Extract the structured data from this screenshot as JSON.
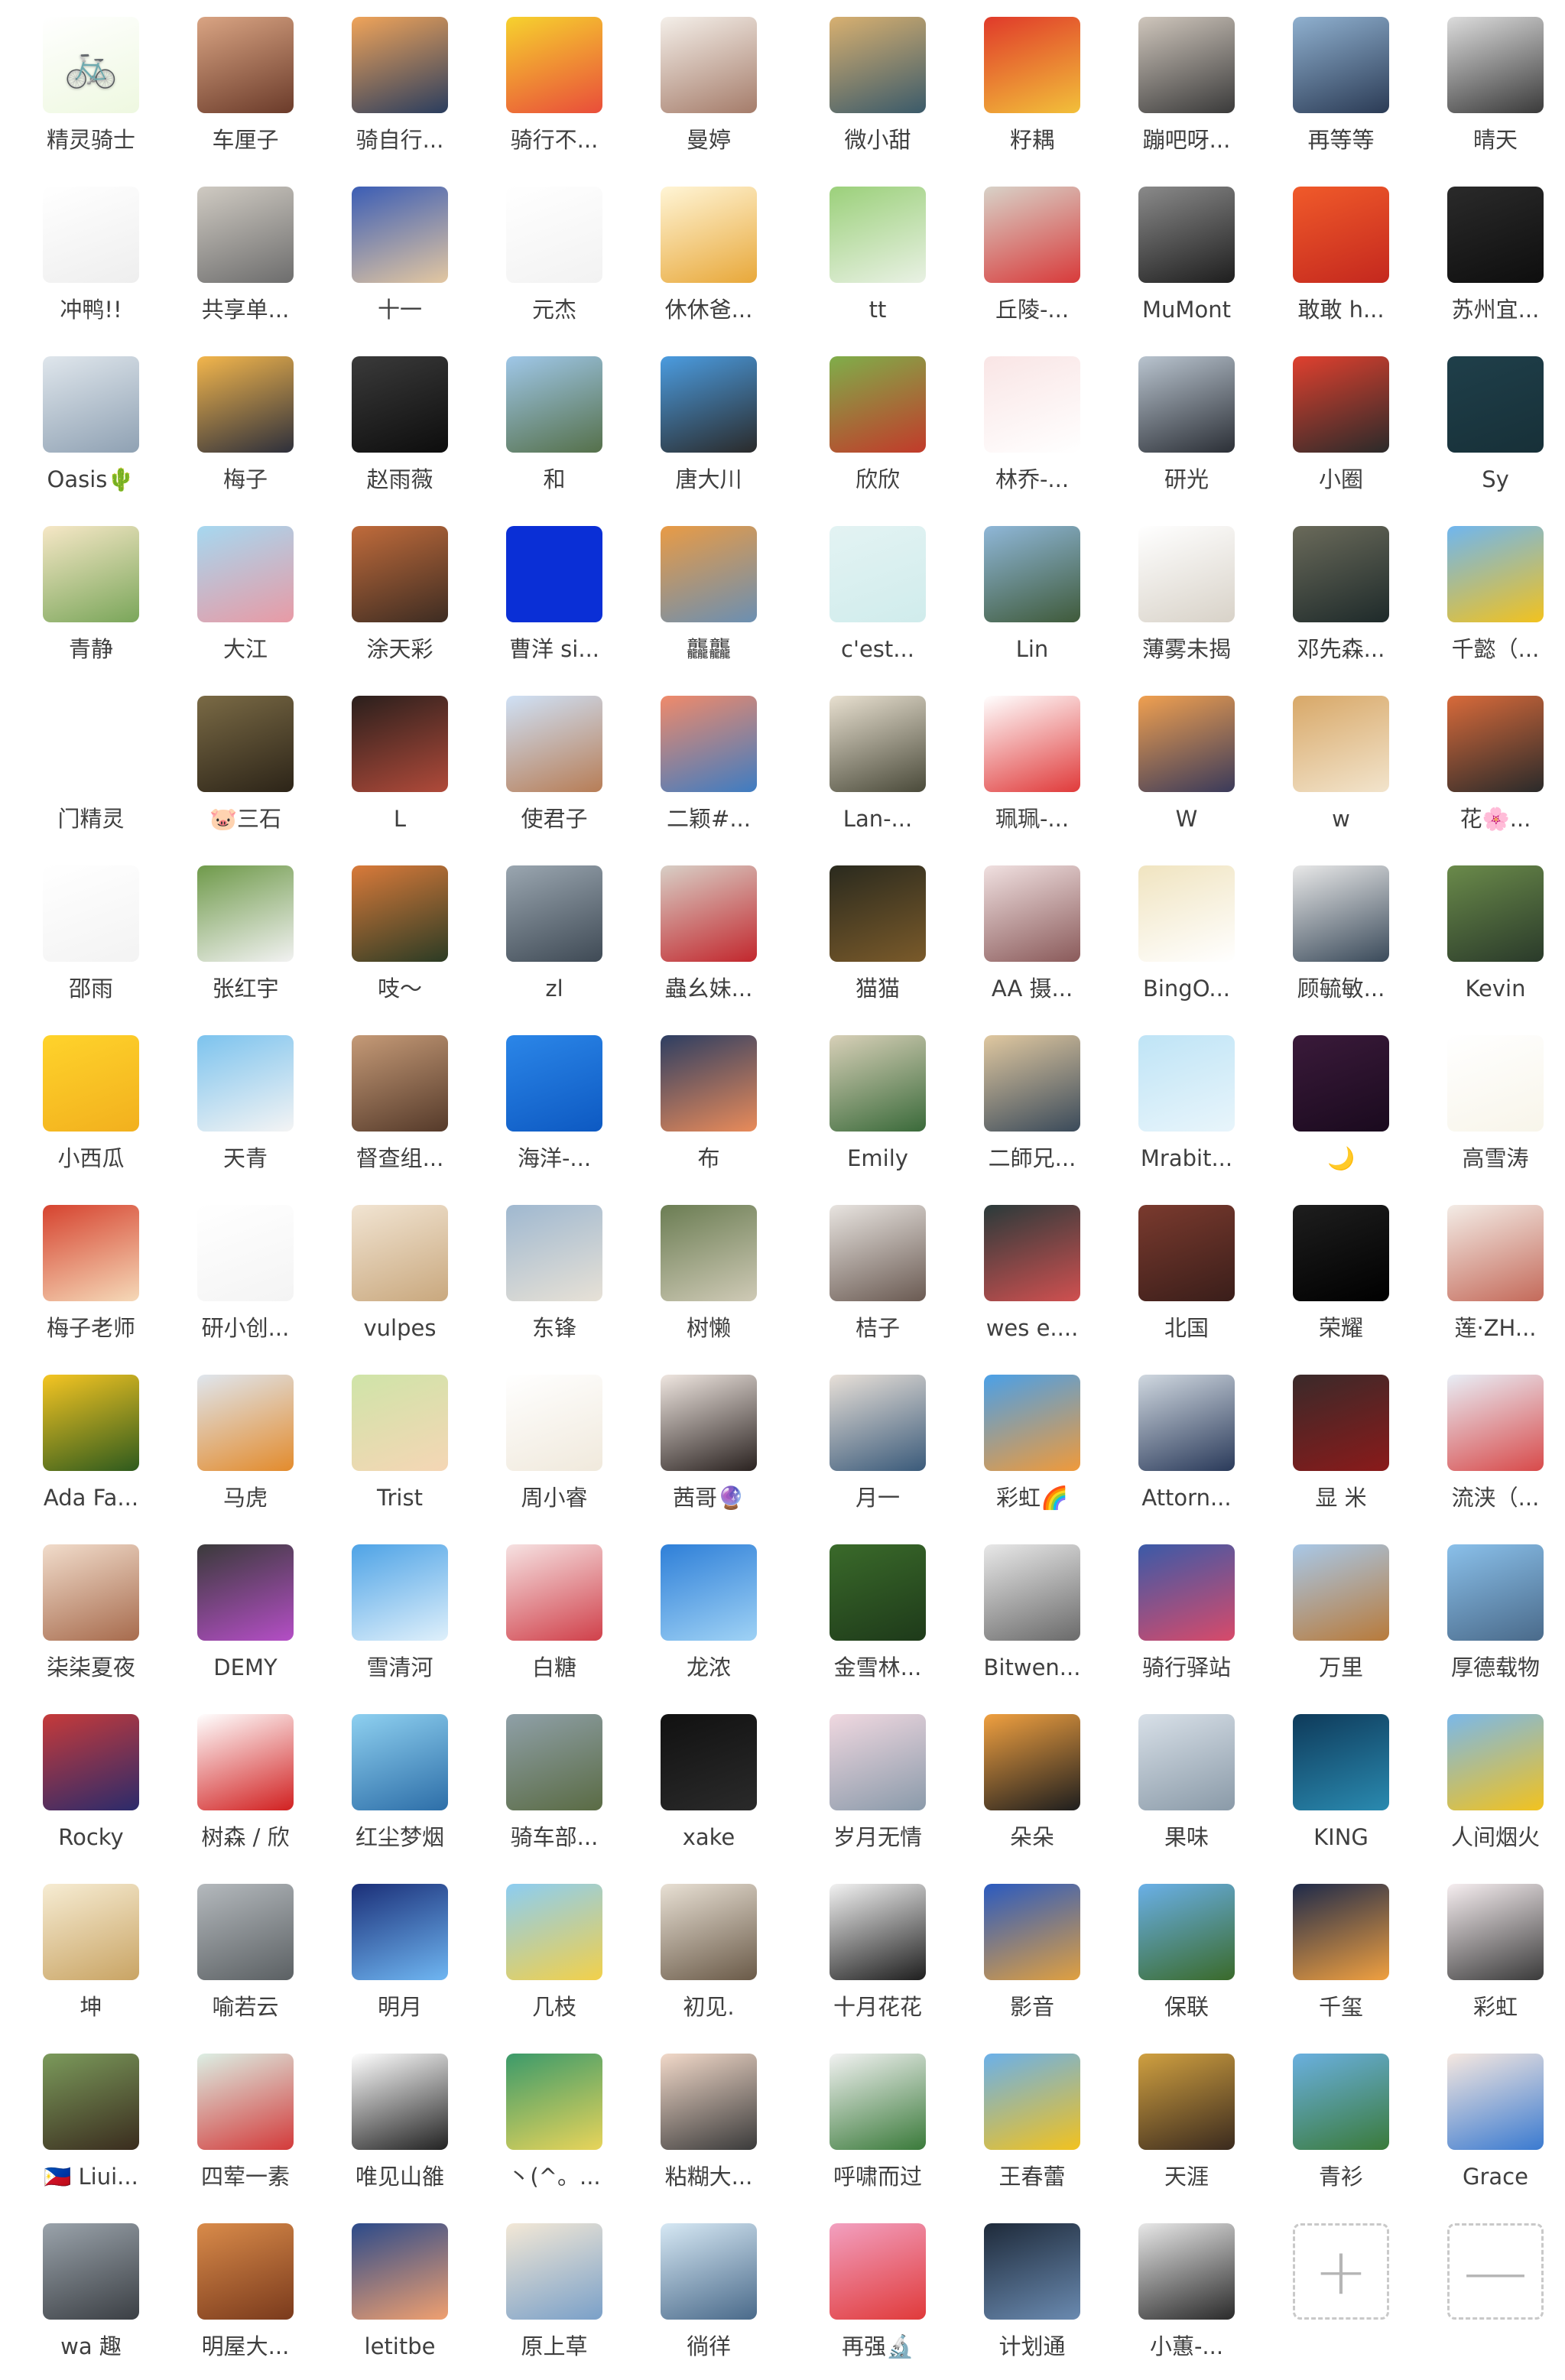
{
  "left_panel": {
    "members": [
      {
        "name": "精灵骑士",
        "colors": [
          "#ffffff",
          "#eef8e0"
        ],
        "icon": "bicycle-logo-icon"
      },
      {
        "name": "车厘子",
        "colors": [
          "#d9a483",
          "#6b3b2a"
        ],
        "icon": "photo"
      },
      {
        "name": "骑自行...",
        "colors": [
          "#f0a45a",
          "#2a3d5e"
        ],
        "icon": "photo"
      },
      {
        "name": "骑行不...",
        "colors": [
          "#f6d22e",
          "#e94d3a"
        ],
        "icon": "photo"
      },
      {
        "name": "曼婷",
        "colors": [
          "#f4efe9",
          "#a57c6a"
        ],
        "icon": "photo"
      },
      {
        "name": "冲鸭!!",
        "colors": [
          "#ffffff",
          "#eeeeee"
        ],
        "icon": "photo"
      },
      {
        "name": "共享单...",
        "colors": [
          "#cfcac2",
          "#6d6d6d"
        ],
        "icon": "photo"
      },
      {
        "name": "十一",
        "colors": [
          "#3b5db5",
          "#e3c7a1"
        ],
        "icon": "photo"
      },
      {
        "name": "元杰",
        "colors": [
          "#ffffff",
          "#f2f2f2"
        ],
        "icon": "photo"
      },
      {
        "name": "休休爸...",
        "colors": [
          "#fff5d6",
          "#e8a83a"
        ],
        "icon": "photo"
      },
      {
        "name": "Oasis🌵",
        "colors": [
          "#dfe6ec",
          "#8fa1b3"
        ],
        "icon": "photo"
      },
      {
        "name": "梅子",
        "colors": [
          "#f3b64c",
          "#2d2f3b"
        ],
        "icon": "photo"
      },
      {
        "name": "赵雨薇",
        "colors": [
          "#3a3a3a",
          "#0d0d0d"
        ],
        "icon": "photo"
      },
      {
        "name": "和",
        "colors": [
          "#9fc7e8",
          "#55704a"
        ],
        "icon": "photo"
      },
      {
        "name": "唐大川",
        "colors": [
          "#4b9ce0",
          "#2a2a2a"
        ],
        "icon": "photo"
      },
      {
        "name": "青静",
        "colors": [
          "#f6e7c6",
          "#7aa65a"
        ],
        "icon": "photo"
      },
      {
        "name": "大江",
        "colors": [
          "#a6d8f0",
          "#e89aa5"
        ],
        "icon": "photo"
      },
      {
        "name": "涂天彩",
        "colors": [
          "#c06b3b",
          "#3d2c22"
        ],
        "icon": "photo"
      },
      {
        "name": "曹洋 si...",
        "colors": [
          "#0a2fd6",
          "#0a2fd6"
        ],
        "icon": "solid"
      },
      {
        "name": "龘龘",
        "colors": [
          "#e99b45",
          "#6b8fb2"
        ],
        "icon": "photo"
      },
      {
        "name": "门精灵",
        "colors": [
          "#ffffff",
          "#ffffff"
        ],
        "icon": "photo"
      },
      {
        "name": "🐷三石",
        "colors": [
          "#7a6a45",
          "#2c2418"
        ],
        "icon": "photo"
      },
      {
        "name": "L",
        "colors": [
          "#2a1f1c",
          "#b04a3a"
        ],
        "icon": "photo"
      },
      {
        "name": "使君子",
        "colors": [
          "#cfe1f6",
          "#b77d56"
        ],
        "icon": "photo"
      },
      {
        "name": "二颖#...",
        "colors": [
          "#f08a6a",
          "#3e7cc2"
        ],
        "icon": "photo"
      },
      {
        "name": "邵雨",
        "colors": [
          "#ffffff",
          "#f3f3f3"
        ],
        "icon": "photo"
      },
      {
        "name": "张红宇",
        "colors": [
          "#6f9a4a",
          "#f2f2f2"
        ],
        "icon": "photo"
      },
      {
        "name": "吱～",
        "colors": [
          "#d97a3a",
          "#2b3b24"
        ],
        "icon": "photo"
      },
      {
        "name": "zl",
        "colors": [
          "#9aa6b0",
          "#3f4a55"
        ],
        "icon": "photo"
      },
      {
        "name": "蟲幺妹...",
        "colors": [
          "#d8cfc6",
          "#c2272d"
        ],
        "icon": "photo"
      },
      {
        "name": "小西瓜",
        "colors": [
          "#ffd32b",
          "#f2b01e"
        ],
        "icon": "photo"
      },
      {
        "name": "天青",
        "colors": [
          "#7cc3ee",
          "#f4f4f4"
        ],
        "icon": "photo"
      },
      {
        "name": "督查组...",
        "colors": [
          "#c59a77",
          "#553a2a"
        ],
        "icon": "photo"
      },
      {
        "name": "海洋-...",
        "colors": [
          "#2b86e8",
          "#0d59c2"
        ],
        "icon": "photo"
      },
      {
        "name": "布",
        "colors": [
          "#2d3e62",
          "#e98b5a"
        ],
        "icon": "photo"
      },
      {
        "name": "梅子老师",
        "colors": [
          "#d6432f",
          "#f5d9b8"
        ],
        "icon": "photo"
      },
      {
        "name": "研小创...",
        "colors": [
          "#ffffff",
          "#f4f4f4"
        ],
        "icon": "photo"
      },
      {
        "name": "vulpes",
        "colors": [
          "#f1e4d2",
          "#c9a87e"
        ],
        "icon": "photo"
      },
      {
        "name": "东锋",
        "colors": [
          "#9fb8d0",
          "#e7e1d6"
        ],
        "icon": "photo"
      },
      {
        "name": "树懒",
        "colors": [
          "#6b7d53",
          "#cfcab6"
        ],
        "icon": "photo"
      },
      {
        "name": "Ada Fa...",
        "colors": [
          "#f5c522",
          "#2e5a1d"
        ],
        "icon": "photo"
      },
      {
        "name": "马虎",
        "colors": [
          "#dfe6ee",
          "#e38b2c"
        ],
        "icon": "photo"
      },
      {
        "name": "Trist",
        "colors": [
          "#cfe4a8",
          "#f5d6b5"
        ],
        "icon": "photo"
      },
      {
        "name": "周小睿",
        "colors": [
          "#ffffff",
          "#f0e9dc"
        ],
        "icon": "photo"
      },
      {
        "name": "茜哥🔮",
        "colors": [
          "#efe6e0",
          "#2a2220"
        ],
        "icon": "photo"
      },
      {
        "name": "柒柒夏夜",
        "colors": [
          "#f1dccb",
          "#a76b4d"
        ],
        "icon": "photo"
      },
      {
        "name": "DEMY",
        "colors": [
          "#3a3a3a",
          "#b44ec6"
        ],
        "icon": "photo"
      },
      {
        "name": "雪清河",
        "colors": [
          "#4ea3e6",
          "#dff0fb"
        ],
        "icon": "photo"
      },
      {
        "name": "白糖",
        "colors": [
          "#f6e2e2",
          "#d0404a"
        ],
        "icon": "photo"
      },
      {
        "name": "龙浓",
        "colors": [
          "#2e7fd8",
          "#9fd2f5"
        ],
        "icon": "photo"
      },
      {
        "name": "Rocky",
        "colors": [
          "#c63a3a",
          "#2b2b6b"
        ],
        "icon": "photo"
      },
      {
        "name": "树森 / 欣",
        "colors": [
          "#ffffff",
          "#d12020"
        ],
        "icon": "photo"
      },
      {
        "name": "红尘梦烟",
        "colors": [
          "#8ed0f0",
          "#2d6ea8"
        ],
        "icon": "photo"
      },
      {
        "name": "骑车部...",
        "colors": [
          "#8fa0a8",
          "#5a6b44"
        ],
        "icon": "photo"
      },
      {
        "name": "xake",
        "colors": [
          "#111111",
          "#2a2a2a"
        ],
        "icon": "photo"
      },
      {
        "name": "坤",
        "colors": [
          "#f6ecd3",
          "#c9a464"
        ],
        "icon": "photo"
      },
      {
        "name": "喻若云",
        "colors": [
          "#b4b9bd",
          "#5b6063"
        ],
        "icon": "photo"
      },
      {
        "name": "明月",
        "colors": [
          "#1b2f78",
          "#6fb6f2"
        ],
        "icon": "photo"
      },
      {
        "name": "几枝",
        "colors": [
          "#8ccdf2",
          "#f2d04a"
        ],
        "icon": "photo"
      },
      {
        "name": "初见.",
        "colors": [
          "#e8e0d4",
          "#6a5a48"
        ],
        "icon": "photo"
      },
      {
        "name": "🇵🇭 Liui...",
        "colors": [
          "#7b9a5b",
          "#3a2c1e"
        ],
        "icon": "photo"
      },
      {
        "name": "四荤一素",
        "colors": [
          "#dcefe4",
          "#d33a3a"
        ],
        "icon": "photo"
      },
      {
        "name": "唯见山雒",
        "colors": [
          "#ffffff",
          "#222222"
        ],
        "icon": "photo"
      },
      {
        "name": "丶(^。...",
        "colors": [
          "#3b9a6a",
          "#e8d45a"
        ],
        "icon": "photo"
      },
      {
        "name": "粘糊大...",
        "colors": [
          "#f2d9c9",
          "#3a3a3a"
        ],
        "icon": "photo"
      },
      {
        "name": "wa 趣",
        "colors": [
          "#9aa3ab",
          "#3b3f44"
        ],
        "icon": "photo"
      },
      {
        "name": "明屋大...",
        "colors": [
          "#d98b4a",
          "#7a3a1c"
        ],
        "icon": "photo"
      },
      {
        "name": "letitbe",
        "colors": [
          "#2b4a8a",
          "#f0a070"
        ],
        "icon": "photo"
      },
      {
        "name": "原上草",
        "colors": [
          "#f3e8d6",
          "#7aa0c8"
        ],
        "icon": "photo"
      },
      {
        "name": "徜徉",
        "colors": [
          "#d6e8f4",
          "#4a6a8a"
        ],
        "icon": "photo"
      }
    ]
  },
  "right_panel": {
    "members": [
      {
        "name": "微小甜",
        "colors": [
          "#d8b070",
          "#3a5a6a"
        ],
        "icon": "photo"
      },
      {
        "name": "籽耦",
        "colors": [
          "#e03a2a",
          "#f2c03a"
        ],
        "icon": "photo"
      },
      {
        "name": "蹦吧呀...",
        "colors": [
          "#cfc6bc",
          "#3a3a3a"
        ],
        "icon": "photo"
      },
      {
        "name": "再等等",
        "colors": [
          "#8fb0cf",
          "#2b3b55"
        ],
        "icon": "photo"
      },
      {
        "name": "晴天",
        "colors": [
          "#dcdcdc",
          "#3a3a3a"
        ],
        "icon": "photo"
      },
      {
        "name": "tt",
        "colors": [
          "#9bd07a",
          "#e9f1e4"
        ],
        "icon": "photo"
      },
      {
        "name": "丘陵-...",
        "colors": [
          "#d8d2c8",
          "#d83a3a"
        ],
        "icon": "photo"
      },
      {
        "name": "MuMont",
        "colors": [
          "#8a8a8a",
          "#1e1e1e"
        ],
        "icon": "photo"
      },
      {
        "name": "敢敢 h...",
        "colors": [
          "#f05a2a",
          "#c4281e"
        ],
        "icon": "photo"
      },
      {
        "name": "苏州宜...",
        "colors": [
          "#2a2a2a",
          "#0e0e0e"
        ],
        "icon": "photo"
      },
      {
        "name": "欣欣",
        "colors": [
          "#7fae4a",
          "#c23a2a"
        ],
        "icon": "photo"
      },
      {
        "name": "林乔-...",
        "colors": [
          "#f9e5e5",
          "#ffffff"
        ],
        "icon": "photo"
      },
      {
        "name": "研光",
        "colors": [
          "#b9c4cf",
          "#2b2f36"
        ],
        "icon": "photo"
      },
      {
        "name": "小圈",
        "colors": [
          "#e0402e",
          "#2a2a2a"
        ],
        "icon": "photo"
      },
      {
        "name": "Sy",
        "colors": [
          "#1f3f4a",
          "#173038"
        ],
        "icon": "photo"
      },
      {
        "name": "c'est...",
        "colors": [
          "#e3f3f3",
          "#d0ecec"
        ],
        "icon": "photo"
      },
      {
        "name": "Lin",
        "colors": [
          "#8fb7d8",
          "#3f5a3a"
        ],
        "icon": "photo"
      },
      {
        "name": "薄雾未揭",
        "colors": [
          "#ffffff",
          "#d8d2c8"
        ],
        "icon": "photo"
      },
      {
        "name": "邓先森...",
        "colors": [
          "#6a6a5a",
          "#1e2a2a"
        ],
        "icon": "photo"
      },
      {
        "name": "千懿（...",
        "colors": [
          "#6fb6f0",
          "#f2c21e"
        ],
        "icon": "photo"
      },
      {
        "name": "Lan-...",
        "colors": [
          "#e8e0d0",
          "#4a4a3a"
        ],
        "icon": "photo"
      },
      {
        "name": "珮珮-...",
        "colors": [
          "#ffffff",
          "#e03a3a"
        ],
        "icon": "photo"
      },
      {
        "name": "W",
        "colors": [
          "#f0a050",
          "#3a3a5a"
        ],
        "icon": "photo"
      },
      {
        "name": "w",
        "colors": [
          "#d8a868",
          "#f2e4cc"
        ],
        "icon": "photo"
      },
      {
        "name": "花🌸...",
        "colors": [
          "#d86a3a",
          "#2a2a2a"
        ],
        "icon": "photo"
      },
      {
        "name": "猫猫",
        "colors": [
          "#2a2a1e",
          "#7a5a2a"
        ],
        "icon": "photo"
      },
      {
        "name": "AA 摄...",
        "colors": [
          "#f0e0e0",
          "#8a5a5a"
        ],
        "icon": "photo"
      },
      {
        "name": "BingO...",
        "colors": [
          "#f0e4c0",
          "#ffffff"
        ],
        "icon": "photo"
      },
      {
        "name": "顾毓敏...",
        "colors": [
          "#e8e8e8",
          "#3a4a5a"
        ],
        "icon": "photo"
      },
      {
        "name": "Kevin",
        "colors": [
          "#6a8a4a",
          "#2a3a2a"
        ],
        "icon": "photo"
      },
      {
        "name": "Emily",
        "colors": [
          "#d8d0b8",
          "#3a6a3a"
        ],
        "icon": "photo"
      },
      {
        "name": "二師兄...",
        "colors": [
          "#e0c8a0",
          "#3a4a5a"
        ],
        "icon": "photo"
      },
      {
        "name": "Mrabit...",
        "colors": [
          "#bfe4f6",
          "#e8f5fb"
        ],
        "icon": "photo"
      },
      {
        "name": "🌙",
        "colors": [
          "#3a1a3a",
          "#1a0a1e"
        ],
        "icon": "photo"
      },
      {
        "name": "高雪涛",
        "colors": [
          "#ffffff",
          "#f8f5ea"
        ],
        "icon": "photo"
      },
      {
        "name": "桔子",
        "colors": [
          "#e8e4e0",
          "#6a5a52"
        ],
        "icon": "photo"
      },
      {
        "name": "wes e....",
        "colors": [
          "#2a3a3a",
          "#d05050"
        ],
        "icon": "photo"
      },
      {
        "name": "北国",
        "colors": [
          "#7a3a2e",
          "#3a1e1a"
        ],
        "icon": "photo"
      },
      {
        "name": "荣耀",
        "colors": [
          "#1e1e1e",
          "#000000"
        ],
        "icon": "photo"
      },
      {
        "name": "莲·ZH...",
        "colors": [
          "#f3ece6",
          "#c46a5a"
        ],
        "icon": "photo"
      },
      {
        "name": "月一",
        "colors": [
          "#e8e0d8",
          "#3a5a7a"
        ],
        "icon": "photo"
      },
      {
        "name": "彩虹🌈",
        "colors": [
          "#4aa0e8",
          "#f09a3a"
        ],
        "icon": "photo"
      },
      {
        "name": "Attorn...",
        "colors": [
          "#d0d8e0",
          "#2a3a5a"
        ],
        "icon": "photo"
      },
      {
        "name": "显 米",
        "colors": [
          "#3a2a2a",
          "#8a1a1a"
        ],
        "icon": "photo"
      },
      {
        "name": "流浃（...",
        "colors": [
          "#e8eef6",
          "#d84a4a"
        ],
        "icon": "photo"
      },
      {
        "name": "金雪林...",
        "colors": [
          "#3a6a2a",
          "#1e3a1a"
        ],
        "icon": "photo"
      },
      {
        "name": "Bitwen...",
        "colors": [
          "#e8e8e8",
          "#6a6a6a"
        ],
        "icon": "photo"
      },
      {
        "name": "骑行驿站",
        "colors": [
          "#3a5aa8",
          "#d84a6a"
        ],
        "icon": "photo"
      },
      {
        "name": "万里",
        "colors": [
          "#a8c8e8",
          "#b87a3a"
        ],
        "icon": "photo"
      },
      {
        "name": "厚德载物",
        "colors": [
          "#8ac0ea",
          "#4a6a8a"
        ],
        "icon": "photo"
      },
      {
        "name": "岁月无情",
        "colors": [
          "#f0d8e0",
          "#8a9aaa"
        ],
        "icon": "photo"
      },
      {
        "name": "朵朵",
        "colors": [
          "#f0a040",
          "#1e1e1e"
        ],
        "icon": "photo"
      },
      {
        "name": "果味",
        "colors": [
          "#d8e0e8",
          "#8a9aa8"
        ],
        "icon": "photo"
      },
      {
        "name": "KING",
        "colors": [
          "#0e3a5a",
          "#2a8ab0"
        ],
        "icon": "photo"
      },
      {
        "name": "人间烟火",
        "colors": [
          "#7ab8ea",
          "#f2c21e"
        ],
        "icon": "photo"
      },
      {
        "name": "十月花花",
        "colors": [
          "#f2f2f2",
          "#1e1e1e"
        ],
        "icon": "photo"
      },
      {
        "name": "影音",
        "colors": [
          "#2a5ac0",
          "#e0a040"
        ],
        "icon": "photo"
      },
      {
        "name": "保联",
        "colors": [
          "#6ab0e8",
          "#3a6a2a"
        ],
        "icon": "photo"
      },
      {
        "name": "千玺",
        "colors": [
          "#1e2a4a",
          "#f0a040"
        ],
        "icon": "photo"
      },
      {
        "name": "彩虹",
        "colors": [
          "#f6eef0",
          "#3a3a3a"
        ],
        "icon": "photo"
      },
      {
        "name": "呼啸而过",
        "colors": [
          "#f2f2f2",
          "#3a7a3a"
        ],
        "icon": "photo"
      },
      {
        "name": "王春蕾",
        "colors": [
          "#6ab0ea",
          "#f2c21e"
        ],
        "icon": "photo"
      },
      {
        "name": "天涯",
        "colors": [
          "#d0a040",
          "#3a2a1e"
        ],
        "icon": "photo"
      },
      {
        "name": "青衫",
        "colors": [
          "#6ab0e0",
          "#3a7a3a"
        ],
        "icon": "photo"
      },
      {
        "name": "Grace",
        "colors": [
          "#f6e8e0",
          "#3a7ad0"
        ],
        "icon": "photo"
      },
      {
        "name": "再强🔬",
        "colors": [
          "#f2a0c0",
          "#e03a3a"
        ],
        "icon": "photo"
      },
      {
        "name": "计划通",
        "colors": [
          "#1e2a3a",
          "#6a8ab0"
        ],
        "icon": "photo"
      },
      {
        "name": "小蕙-...",
        "colors": [
          "#e8e8e8",
          "#2a2a2a"
        ],
        "icon": "photo"
      },
      {
        "name": "",
        "colors": [
          "#ffffff",
          "#ffffff"
        ],
        "icon": "plus-icon",
        "action": "add"
      },
      {
        "name": "",
        "colors": [
          "#ffffff",
          "#ffffff"
        ],
        "icon": "minus-icon",
        "action": "remove"
      }
    ]
  }
}
